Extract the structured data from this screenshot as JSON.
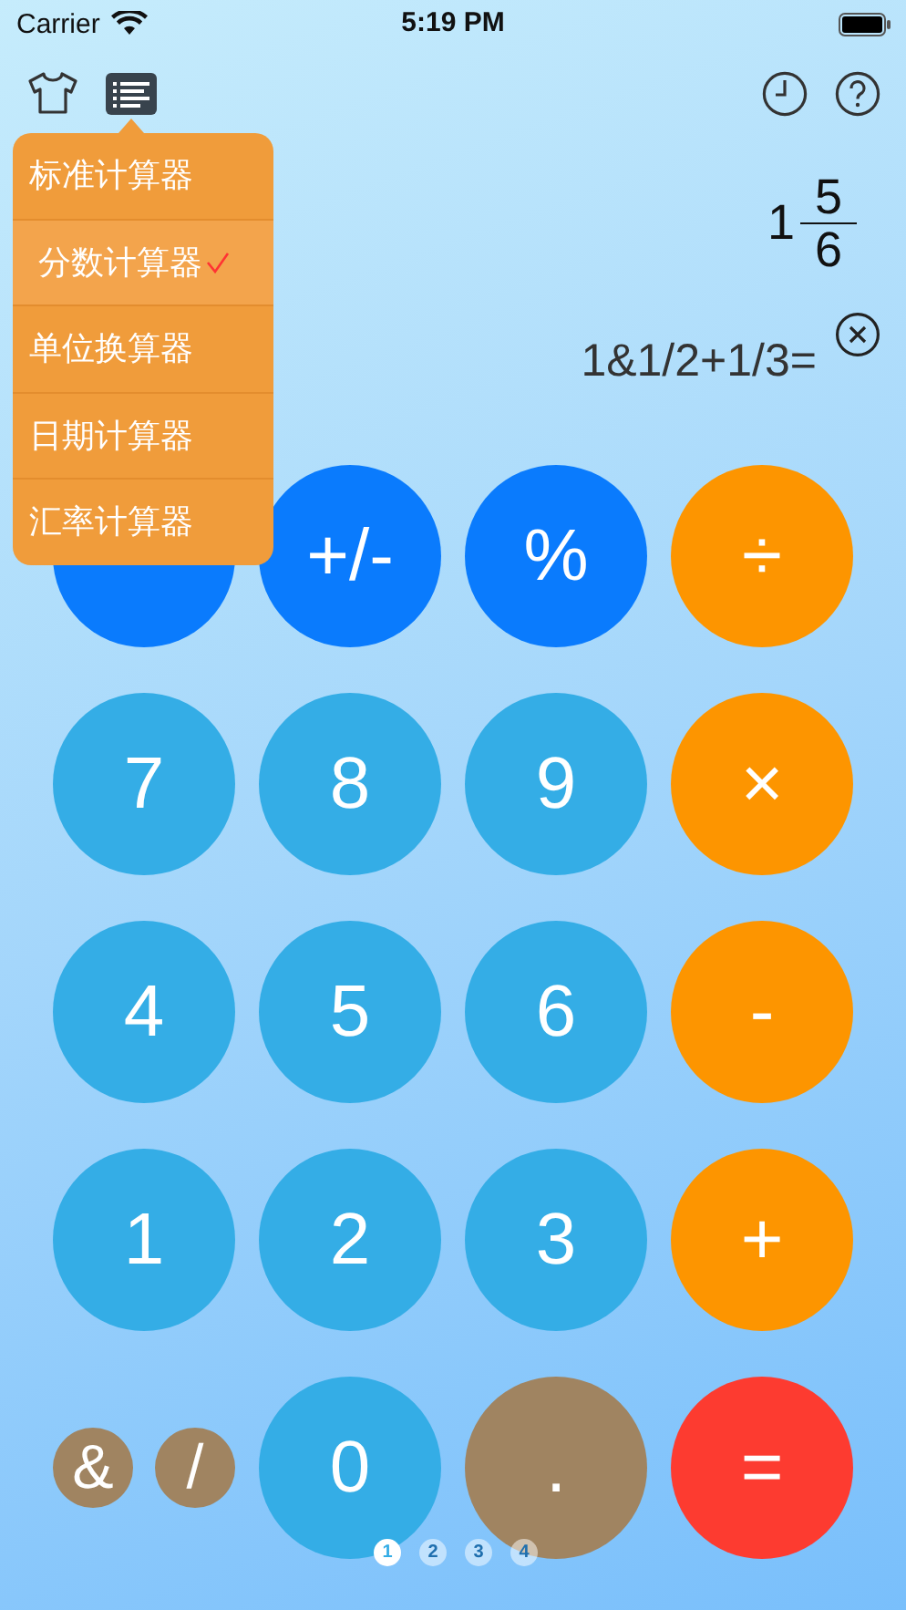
{
  "status_bar": {
    "carrier": "Carrier",
    "time": "5:19 PM"
  },
  "menu": {
    "items": [
      {
        "label": "标准计算器",
        "selected": false
      },
      {
        "label": "分数计算器",
        "selected": true
      },
      {
        "label": "单位换算器",
        "selected": false
      },
      {
        "label": "日期计算器",
        "selected": false
      },
      {
        "label": "汇率计算器",
        "selected": false
      }
    ]
  },
  "display": {
    "result": {
      "whole": "1",
      "numerator": "5",
      "denominator": "6"
    },
    "expression": "1&1/2+1/3="
  },
  "keys": [
    [
      {
        "kind": "function"
      },
      {
        "label": "+/-",
        "kind": "function"
      },
      {
        "label": "%",
        "kind": "function"
      },
      {
        "label": "÷",
        "kind": "operator"
      }
    ],
    [
      {
        "label": "7",
        "kind": "digit"
      },
      {
        "label": "8",
        "kind": "digit"
      },
      {
        "label": "9",
        "kind": "digit"
      },
      {
        "label": "×",
        "kind": "operator"
      }
    ],
    [
      {
        "label": "4",
        "kind": "digit"
      },
      {
        "label": "5",
        "kind": "digit"
      },
      {
        "label": "6",
        "kind": "digit"
      },
      {
        "label": "-",
        "kind": "operator"
      }
    ],
    [
      {
        "label": "1",
        "kind": "digit"
      },
      {
        "label": "2",
        "kind": "digit"
      },
      {
        "label": "3",
        "kind": "digit"
      },
      {
        "label": "+",
        "kind": "operator"
      }
    ],
    [
      {
        "label": "&",
        "kind": "small"
      },
      {
        "label": "/",
        "kind": "small"
      },
      {
        "label": "0",
        "kind": "digit"
      },
      {
        "label": ".",
        "kind": "symbol"
      },
      {
        "label": "=",
        "kind": "equals"
      }
    ]
  ],
  "pages": [
    {
      "label": "1",
      "selected": true
    },
    {
      "label": "2",
      "selected": false
    },
    {
      "label": "3",
      "selected": false
    },
    {
      "label": "4",
      "selected": false
    }
  ]
}
